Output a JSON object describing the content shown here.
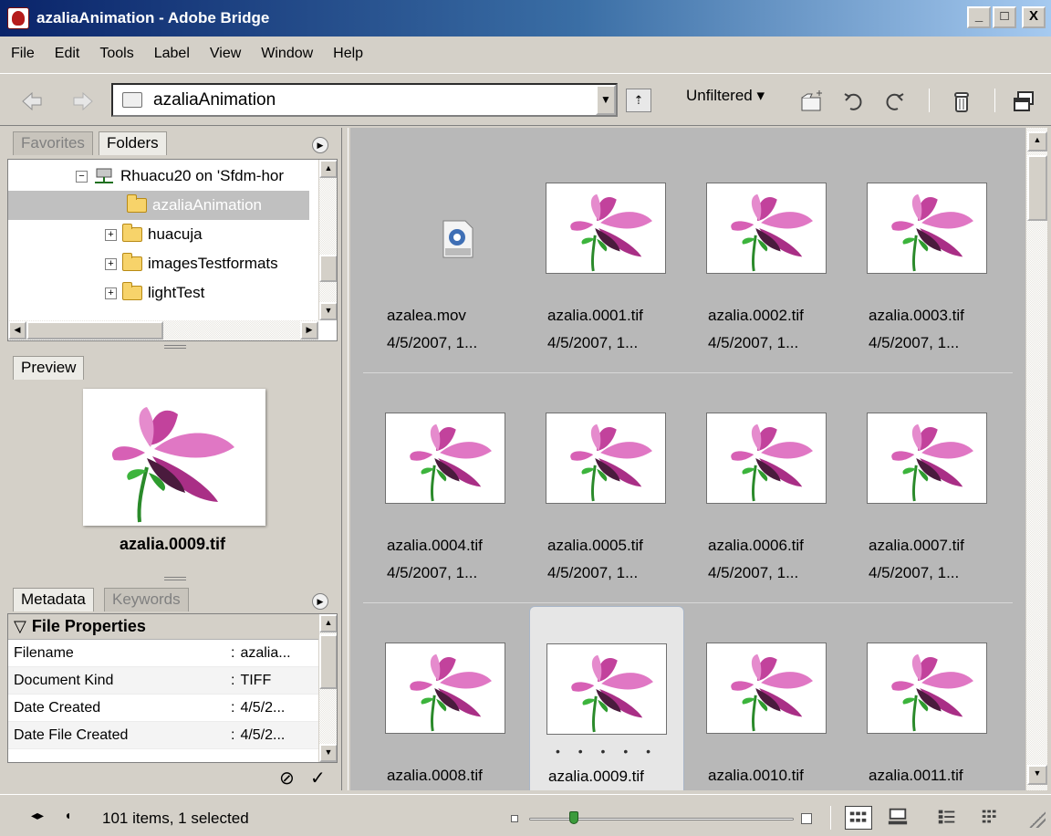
{
  "window": {
    "title": "azaliaAnimation - Adobe Bridge",
    "min": "_",
    "max": "□",
    "close": "X"
  },
  "menu": [
    "File",
    "Edit",
    "Tools",
    "Label",
    "View",
    "Window",
    "Help"
  ],
  "toolbar": {
    "path": "azaliaAnimation",
    "filter": "Unfiltered ▾"
  },
  "left": {
    "tabs": [
      "Favorites",
      "Folders"
    ],
    "tree": [
      {
        "label": "Rhuacu20 on 'Sfdm-hor",
        "expander": "−",
        "type": "server"
      },
      {
        "label": "azaliaAnimation",
        "expander": "",
        "type": "folder",
        "selected": true
      },
      {
        "label": "huacuja",
        "expander": "+",
        "type": "folder"
      },
      {
        "label": "imagesTestformats",
        "expander": "+",
        "type": "folder"
      },
      {
        "label": "lightTest",
        "expander": "+",
        "type": "folder"
      }
    ],
    "preview_tab": "Preview",
    "preview_name": "azalia.0009.tif",
    "meta_tabs": [
      "Metadata",
      "Keywords"
    ],
    "meta_section": "File Properties",
    "meta_rows": [
      {
        "k": "Filename",
        "v": "azalia..."
      },
      {
        "k": "Document Kind",
        "v": "TIFF"
      },
      {
        "k": "Date Created",
        "v": "4/5/2..."
      },
      {
        "k": "Date File Created",
        "v": "4/5/2..."
      }
    ]
  },
  "thumbnails": [
    {
      "name": "azalea.mov",
      "date": "4/5/2007, 1...",
      "kind": "movie"
    },
    {
      "name": "azalia.0001.tif",
      "date": "4/5/2007, 1...",
      "kind": "image"
    },
    {
      "name": "azalia.0002.tif",
      "date": "4/5/2007, 1...",
      "kind": "image"
    },
    {
      "name": "azalia.0003.tif",
      "date": "4/5/2007, 1...",
      "kind": "image"
    },
    {
      "name": "azalia.0004.tif",
      "date": "4/5/2007, 1...",
      "kind": "image"
    },
    {
      "name": "azalia.0005.tif",
      "date": "4/5/2007, 1...",
      "kind": "image"
    },
    {
      "name": "azalia.0006.tif",
      "date": "4/5/2007, 1...",
      "kind": "image"
    },
    {
      "name": "azalia.0007.tif",
      "date": "4/5/2007, 1...",
      "kind": "image"
    },
    {
      "name": "azalia.0008.tif",
      "date": "",
      "kind": "image"
    },
    {
      "name": "azalia.0009.tif",
      "date": "",
      "kind": "image",
      "selected": true,
      "rating": "• • • • •"
    },
    {
      "name": "azalia.0010.tif",
      "date": "",
      "kind": "image"
    },
    {
      "name": "azalia.0011.tif",
      "date": "",
      "kind": "image"
    }
  ],
  "status": {
    "text": "101 items, 1 selected",
    "thumb_size_fraction": 0.17
  },
  "colors": {
    "title_bar": "#0a246a",
    "content_bg": "#b8b8b8",
    "petal": "#d0449a"
  }
}
